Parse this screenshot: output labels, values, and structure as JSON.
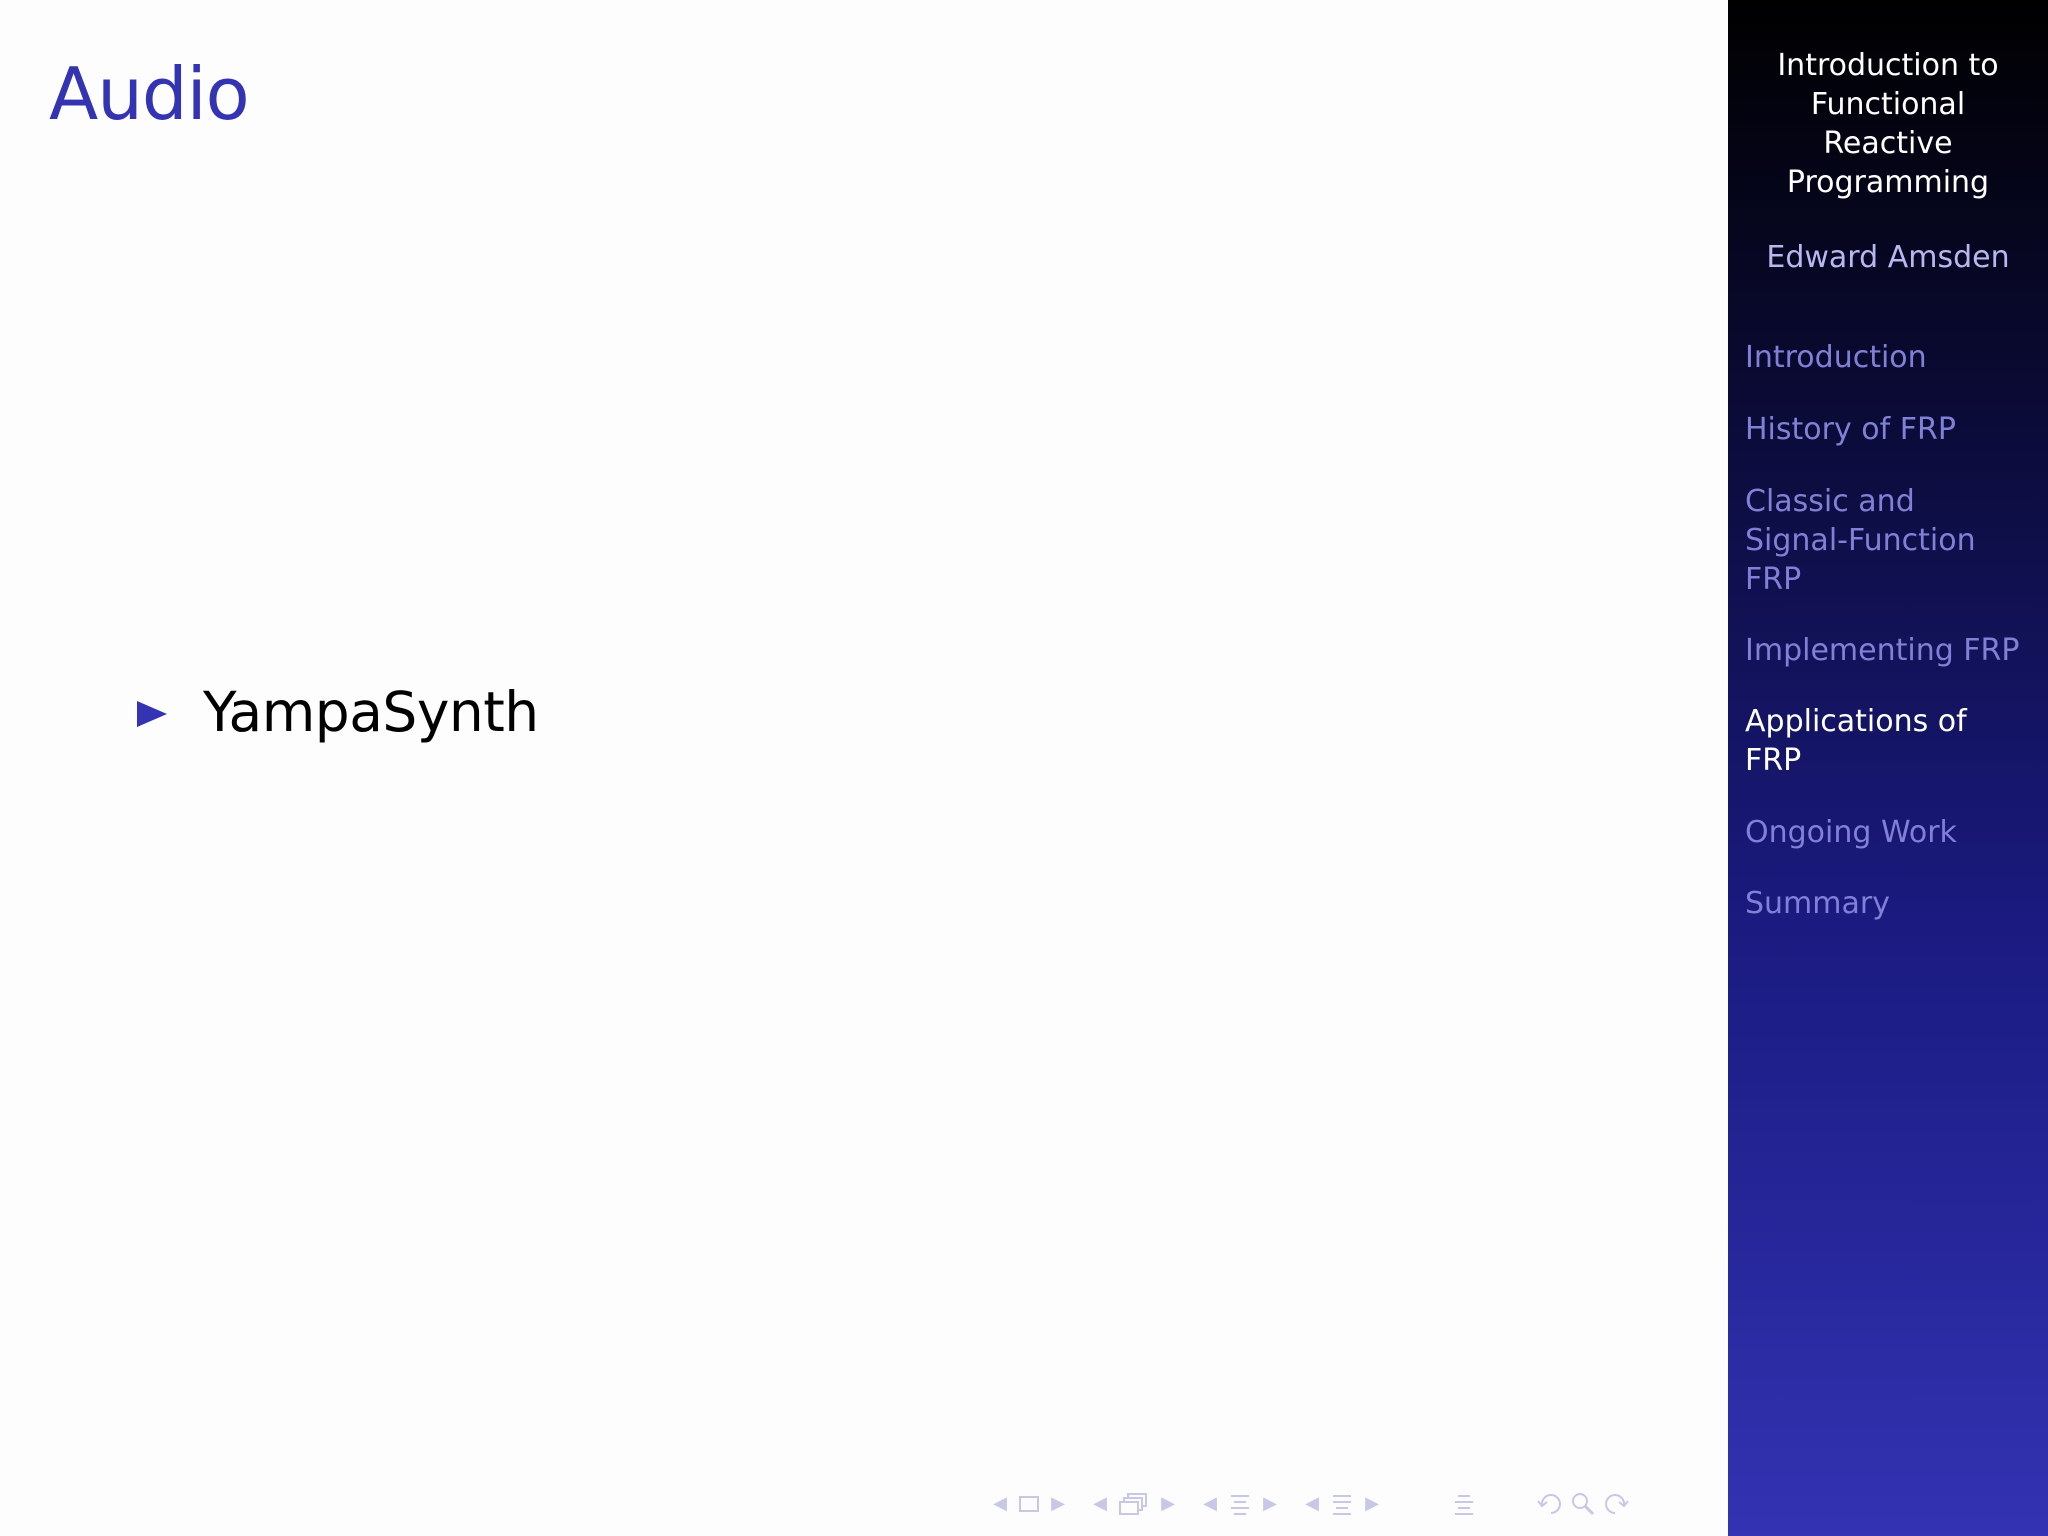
{
  "slide": {
    "title": "Audio",
    "bullets": [
      {
        "text": "YampaSynth"
      }
    ]
  },
  "sidebar": {
    "presentation_title": "Introduction to\nFunctional\nReactive\nProgramming",
    "author": "Edward Amsden",
    "sections": [
      {
        "label": "Introduction",
        "current": false
      },
      {
        "label": "History of FRP",
        "current": false
      },
      {
        "label": "Classic and\nSignal-Function\nFRP",
        "current": false
      },
      {
        "label": "Implementing FRP",
        "current": false
      },
      {
        "label": "Applications of\nFRP",
        "current": true
      },
      {
        "label": "Ongoing Work",
        "current": false
      },
      {
        "label": "Summary",
        "current": false
      }
    ]
  },
  "navigation": {
    "icons": [
      "frame-nav-icon",
      "subsection-nav-icon",
      "section-nav-icon",
      "presentation-nav-icon",
      "appendix-nav-icon",
      "back-icon",
      "search-icon",
      "forward-icon"
    ]
  },
  "colors": {
    "title": "#3333b3",
    "bullet": "#3333b3",
    "sidebar_current": "#ffffff",
    "sidebar_other": "#8080d6"
  }
}
